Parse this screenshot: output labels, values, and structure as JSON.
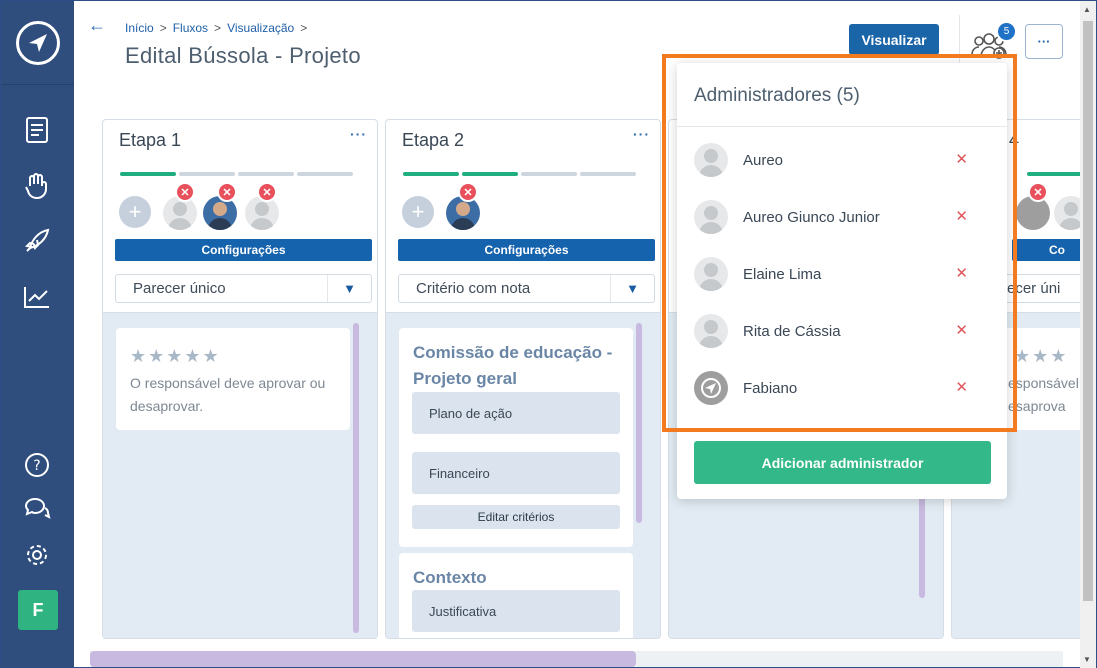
{
  "breadcrumb": {
    "items": [
      "Início",
      "Fluxos",
      "Visualização"
    ],
    "sep": ">"
  },
  "page": {
    "title": "Edital Bússola - Projeto"
  },
  "header": {
    "visualize_label": "Visualizar",
    "users_badge": "5",
    "more_label": "···"
  },
  "sidebar": {
    "user_initial": "F"
  },
  "columns": [
    {
      "title": "Etapa 1",
      "dots": "···",
      "configure_label": "Configurações",
      "select_value": "Parecer único",
      "card_text": "O responsável deve aprovar ou desaprovar.",
      "stars": "★★★★★"
    },
    {
      "title": "Etapa 2",
      "dots": "···",
      "configure_label": "Configurações",
      "select_value": "Critério com nota",
      "groups": [
        {
          "title": "Comissão de educação - Projeto geral",
          "criteria": [
            "Plano de ação",
            "Financeiro"
          ],
          "edit_label": "Editar critérios"
        },
        {
          "title": "Contexto",
          "criteria": [
            "Justificativa"
          ]
        }
      ]
    },
    {
      "title": "4",
      "configure_label": "Co",
      "select_value": "ecer úni",
      "card_text": "esponsável\nesaprova",
      "stars": "★★★"
    }
  ],
  "popup": {
    "title": "Administradores (5)",
    "admins": [
      {
        "name": "Aureo"
      },
      {
        "name": "Aureo Giunco Junior"
      },
      {
        "name": "Elaine Lima"
      },
      {
        "name": "Rita de Cássia"
      },
      {
        "name": "Fabiano"
      }
    ],
    "remove_symbol": "✕",
    "add_label": "Adicionar administrador"
  },
  "colors": {
    "primary": "#1a64a8",
    "accent": "#33b989",
    "sidebar": "#2f4e7e",
    "danger": "#e8505b",
    "highlight": "#f47a20"
  },
  "icons": [
    "logo-icon",
    "document-icon",
    "hand-heart-icon",
    "rocket-icon",
    "chart-icon",
    "help-icon",
    "chat-icon",
    "gear-icon",
    "back-arrow-icon",
    "users-icon",
    "chevron-down-icon",
    "star-icon",
    "close-icon"
  ]
}
